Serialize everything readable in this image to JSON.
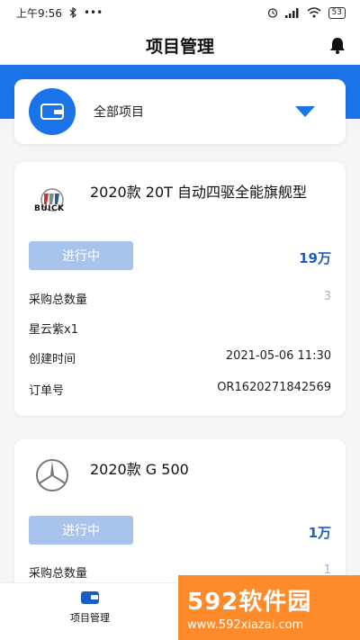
{
  "status_bar": {
    "time": "上午9:56",
    "dots": "•••",
    "battery": "53"
  },
  "nav": {
    "title": "项目管理"
  },
  "filter": {
    "label": "全部项目"
  },
  "projects": [
    {
      "brand": "BUICK",
      "title": "2020款 20T 自动四驱全能旗舰型",
      "status": "进行中",
      "price": "19万",
      "rows": [
        {
          "label": "采购总数量",
          "value": "3"
        },
        {
          "label": "星云紫x1",
          "value": ""
        },
        {
          "label": "创建时间",
          "value": "2021-05-06 11:30"
        },
        {
          "label": "订单号",
          "value": "OR1620271842569"
        }
      ]
    },
    {
      "brand": "",
      "title": "2020款 G 500",
      "status": "进行中",
      "price": "1万",
      "rows": [
        {
          "label": "采购总数量",
          "value": "1"
        }
      ]
    }
  ],
  "tab_bar": {
    "items": [
      {
        "label": "项目管理"
      }
    ]
  },
  "watermark": {
    "main": "592软件园",
    "url": "www.592xiazai.com"
  }
}
